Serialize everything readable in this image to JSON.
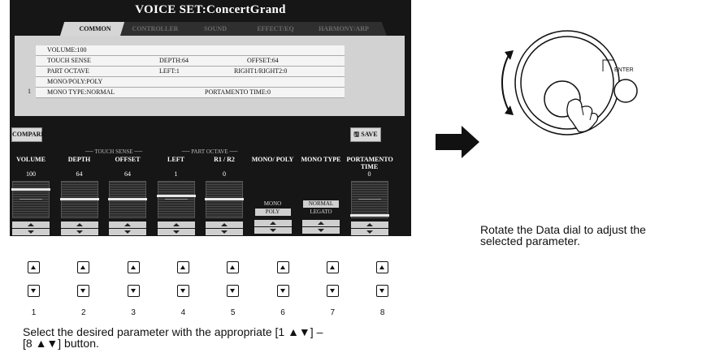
{
  "screen": {
    "title": "VOICE SET:ConcertGrand",
    "tabs": [
      {
        "label": "COMMON",
        "active": true
      },
      {
        "label": "CONTROLLER",
        "active": false
      },
      {
        "label": "SOUND",
        "active": false
      },
      {
        "label": "EFFECT/EQ",
        "active": false
      },
      {
        "label": "HARMONY/ARP",
        "active": false
      }
    ],
    "row_number": "1",
    "params": {
      "volume": "VOLUME:100",
      "touch_sense": "TOUCH SENSE",
      "depth": "DEPTH:64",
      "offset": "OFFSET:64",
      "part_octave": "PART OCTAVE",
      "left": "LEFT:1",
      "right": "RIGHT1/RIGHT2:0",
      "mono_poly": "MONO/POLY:POLY",
      "mono_type": "MONO TYPE:NORMAL",
      "portamento": "PORTAMENTO TIME:0"
    },
    "compare_label": "COMPARE",
    "save_label": "SAVE",
    "group_touch_sense": "TOUCH SENSE",
    "group_part_octave": "PART OCTAVE",
    "columns": [
      {
        "name": "VOLUME",
        "value": "100",
        "level": 0.79
      },
      {
        "name": "DEPTH",
        "value": "64",
        "level": 0.5
      },
      {
        "name": "OFFSET",
        "value": "64",
        "level": 0.5
      },
      {
        "name": "LEFT",
        "value": "1",
        "level": 0.6
      },
      {
        "name": "R1 / R2",
        "value": "0",
        "level": 0.5
      },
      {
        "name": "MONO/ POLY",
        "options": [
          "MONO",
          "POLY"
        ],
        "selected": "POLY"
      },
      {
        "name": "MONO TYPE",
        "options": [
          "NORMAL",
          "LEGATO"
        ],
        "selected": "NORMAL"
      },
      {
        "name": "PORTAMENTO TIME",
        "value": "0",
        "level": 0.0
      }
    ]
  },
  "buttons": {
    "numbers": [
      "1",
      "2",
      "3",
      "4",
      "5",
      "6",
      "7",
      "8"
    ]
  },
  "captions": {
    "select_line1": "Select the desired parameter with the appropriate [1 ▲▼] –",
    "select_line2": "[8 ▲▼] button.",
    "dial_line1": "Rotate the Data dial to adjust the",
    "dial_line2": "selected parameter."
  },
  "dial": {
    "enter_label": "ENTER"
  }
}
